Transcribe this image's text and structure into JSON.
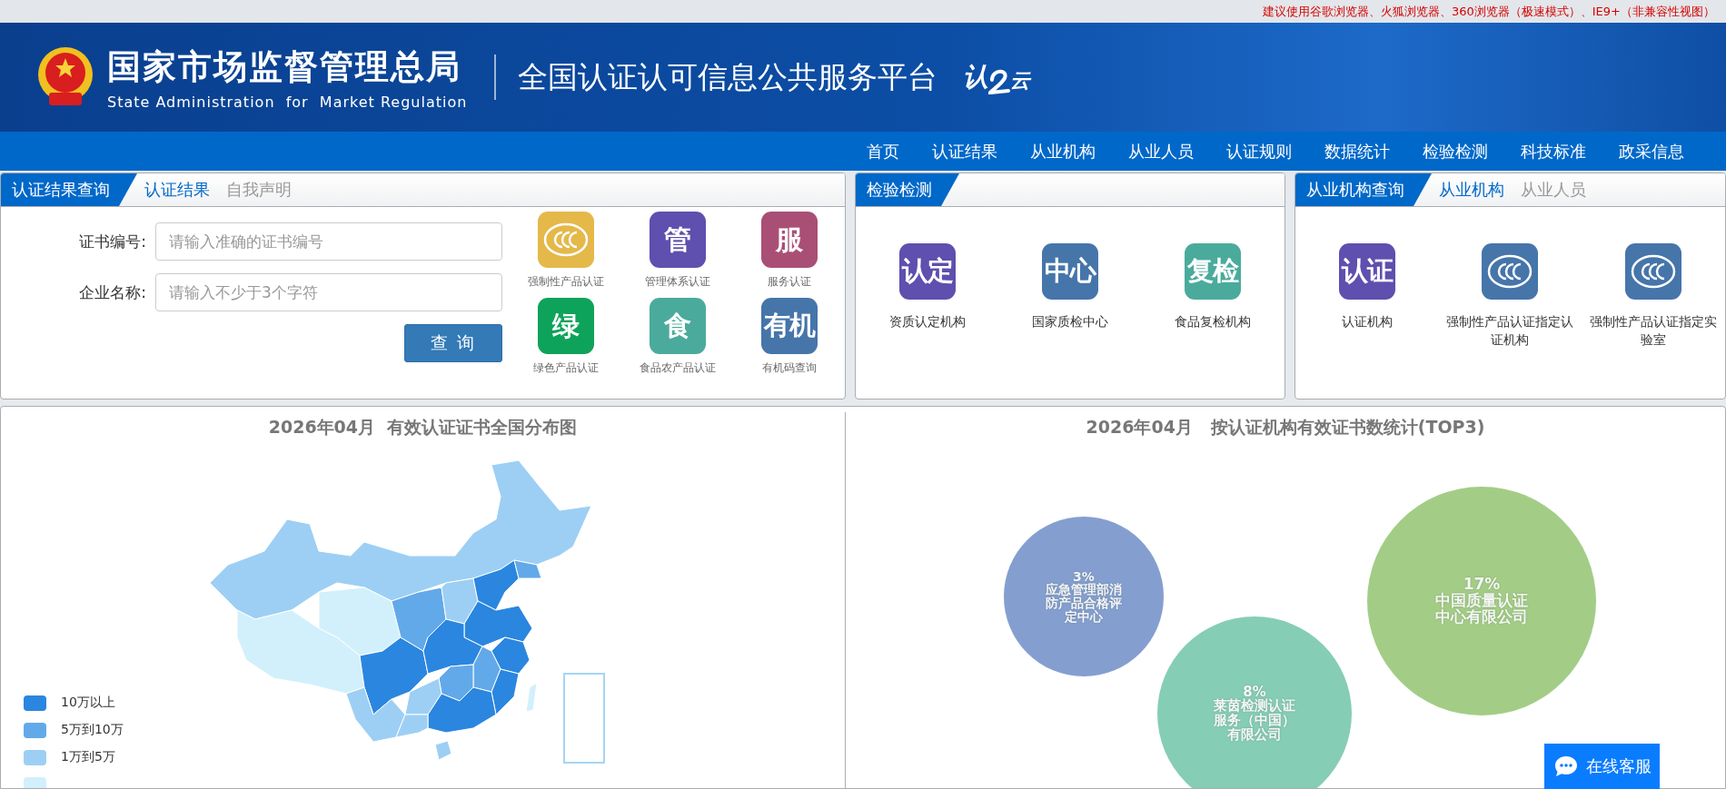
{
  "notice": "建议使用谷歌浏览器、火狐浏览器、360浏览器（极速模式）、IE9+（非兼容性视图）",
  "header": {
    "agency_cn": "国家市场监督管理总局",
    "agency_en": "State Administration  for  Market Regulation",
    "platform": "全国认证认可信息公共服务平台",
    "logo_chars": [
      "认",
      "云"
    ]
  },
  "nav": [
    "首页",
    "认证结果",
    "从业机构",
    "从业人员",
    "认证规则",
    "数据统计",
    "检验检测",
    "科技标准",
    "政采信息"
  ],
  "cert_panel": {
    "title": "认证结果查询",
    "tabs": [
      {
        "label": "认证结果",
        "selected": true
      },
      {
        "label": "自我声明",
        "selected": false
      }
    ],
    "fields": [
      {
        "label": "证书编号:",
        "placeholder": "请输入准确的证书编号"
      },
      {
        "label": "企业名称:",
        "placeholder": "请输入不少于3个字符"
      }
    ],
    "button": "查 询",
    "tiles": [
      {
        "kind": "ccc",
        "label": "强制性产品认证",
        "color": "#e5b84a"
      },
      {
        "kind": "text",
        "glyph": "管",
        "label": "管理体系认证",
        "color": "#5f4fae"
      },
      {
        "kind": "text",
        "glyph": "服",
        "label": "服务认证",
        "color": "#a94f76"
      },
      {
        "kind": "text",
        "glyph": "绿",
        "label": "绿色产品认证",
        "color": "#0ea35a"
      },
      {
        "kind": "text",
        "glyph": "食",
        "label": "食品农产品认证",
        "color": "#4aab9c"
      },
      {
        "kind": "text",
        "glyph": "有机",
        "label": "有机码查询",
        "color": "#4675aa"
      }
    ]
  },
  "inspection_panel": {
    "title": "检验检测",
    "tiles": [
      {
        "kind": "text",
        "glyph": "认定",
        "label": "资质认定机构",
        "color": "#5f4fae"
      },
      {
        "kind": "text",
        "glyph": "中心",
        "label": "国家质检中心",
        "color": "#4675aa"
      },
      {
        "kind": "text",
        "glyph": "复检",
        "label": "食品复检机构",
        "color": "#4aab9c"
      }
    ]
  },
  "org_panel": {
    "title": "从业机构查询",
    "tabs": [
      {
        "label": "从业机构",
        "selected": true
      },
      {
        "label": "从业人员",
        "selected": false
      }
    ],
    "tiles": [
      {
        "kind": "text",
        "glyph": "认证",
        "label": "认证机构",
        "color": "#5f4fae"
      },
      {
        "kind": "ccc",
        "label": "强制性产品认证指定认证机构",
        "color": "#4675aa"
      },
      {
        "kind": "ccc",
        "label": "强制性产品认证指定实验室",
        "color": "#4675aa"
      }
    ]
  },
  "map_section": {
    "title": "2026年04月  有效认证证书全国分布图",
    "legend": [
      {
        "label": "10万以上",
        "color": "#2b86e0"
      },
      {
        "label": "5万到10万",
        "color": "#62a9ea"
      },
      {
        "label": "1万到5万",
        "color": "#9dcff4"
      },
      {
        "color": "#d2f0fb"
      }
    ]
  },
  "bubble_section": {
    "title": "2026年04月   按认证机构有效证书数统计(TOP3)",
    "bubbles": [
      {
        "percent": "3%",
        "name": "应急管理部消防产品合格评定中心",
        "color": "#849fcf"
      },
      {
        "percent": "8%",
        "name": "莱茵检测认证服务（中国）有限公司",
        "color": "#86cdb6"
      },
      {
        "percent": "17%",
        "name": "中国质量认证中心有限公司",
        "color": "#a3cd86"
      }
    ]
  },
  "chat_button": "在线客服"
}
